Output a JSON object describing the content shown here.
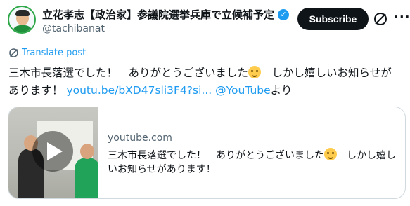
{
  "author": {
    "display_name": "立花孝志【政治家】参議院選挙兵庫で立候補予定",
    "handle": "@tachibanat",
    "verified": true
  },
  "header": {
    "subscribe_label": "Subscribe",
    "more_label": "···"
  },
  "translate": {
    "label": "Translate post"
  },
  "tweet": {
    "text_part1": "三木市長落選でした！　ありがとうございました",
    "text_part2": "　しかし嬉しいお知らせがあります！ ",
    "link_text": "youtu.be/bXD47sli3F4?si...",
    "mention_text": "@YouTube",
    "suffix": "より"
  },
  "card": {
    "domain": "youtube.com",
    "title_part1": "三木市長落選でした！　ありがとうございました",
    "title_part2": "　しかし嬉しいお知らせがあります！"
  },
  "icons": {
    "verified": "verified-badge-icon",
    "grok": "grok-icon",
    "translate": "translate-icon",
    "emoji": "smiling-face-emoji",
    "play": "play-icon"
  },
  "colors": {
    "accent": "#1d9bf0",
    "subscribe_bg": "#0f1419",
    "border": "#cfd9de"
  }
}
